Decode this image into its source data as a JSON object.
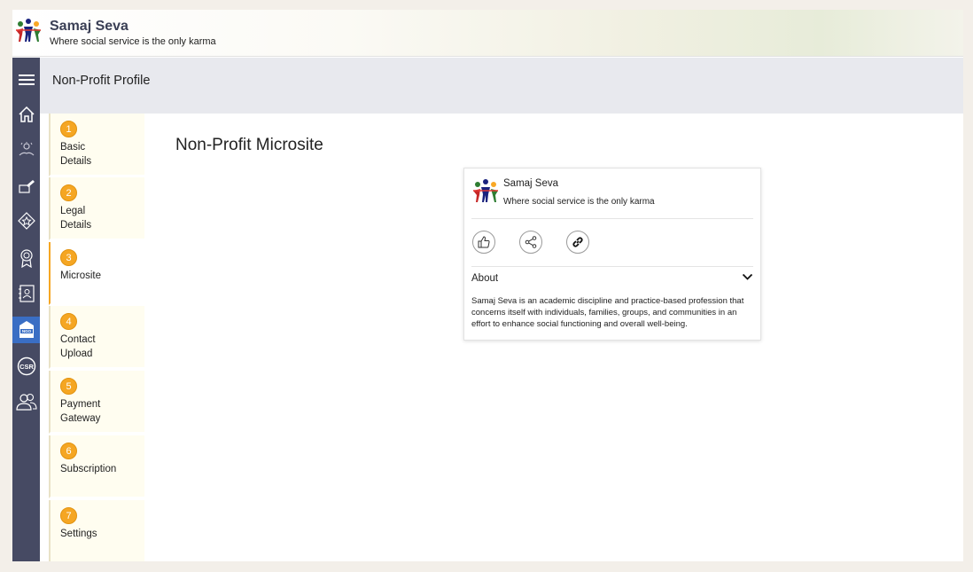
{
  "app": {
    "title": "Samaj Seva",
    "tagline": "Where social service is the only karma"
  },
  "header": {
    "page_title": "Non-Profit Profile"
  },
  "sidebar": {
    "items": [
      {
        "icon": "menu-icon"
      },
      {
        "icon": "home-icon"
      },
      {
        "icon": "charity-icon"
      },
      {
        "icon": "donation-icon"
      },
      {
        "icon": "badge-icon"
      },
      {
        "icon": "award-icon"
      },
      {
        "icon": "contacts-icon"
      },
      {
        "icon": "ngo-icon",
        "label": "NGO",
        "active": true
      },
      {
        "icon": "csr-icon",
        "label": "CSR"
      },
      {
        "icon": "users-icon"
      }
    ]
  },
  "steps": [
    {
      "num": "1",
      "label": "Basic Details"
    },
    {
      "num": "2",
      "label": "Legal Details"
    },
    {
      "num": "3",
      "label": "Microsite",
      "active": true
    },
    {
      "num": "4",
      "label": "Contact Upload"
    },
    {
      "num": "5",
      "label": "Payment Gateway"
    },
    {
      "num": "6",
      "label": "Subscription"
    },
    {
      "num": "7",
      "label": "Settings"
    }
  ],
  "main": {
    "title": "Non-Profit Microsite"
  },
  "microsite_card": {
    "name": "Samaj Seva",
    "tagline": "Where social service is the only karma",
    "actions": [
      "like-icon",
      "share-icon",
      "link-icon"
    ],
    "about_label": "About",
    "about_text": "Samaj Seva is an academic discipline and practice-based profession that concerns itself with individuals, families, groups, and communities in an effort to enhance social functioning and overall well-being."
  },
  "colors": {
    "sidebar_bg": "#464a63",
    "active_blue": "#3a6ec4",
    "step_accent": "#f5a623",
    "subheader_bg": "#e8e9ee"
  }
}
